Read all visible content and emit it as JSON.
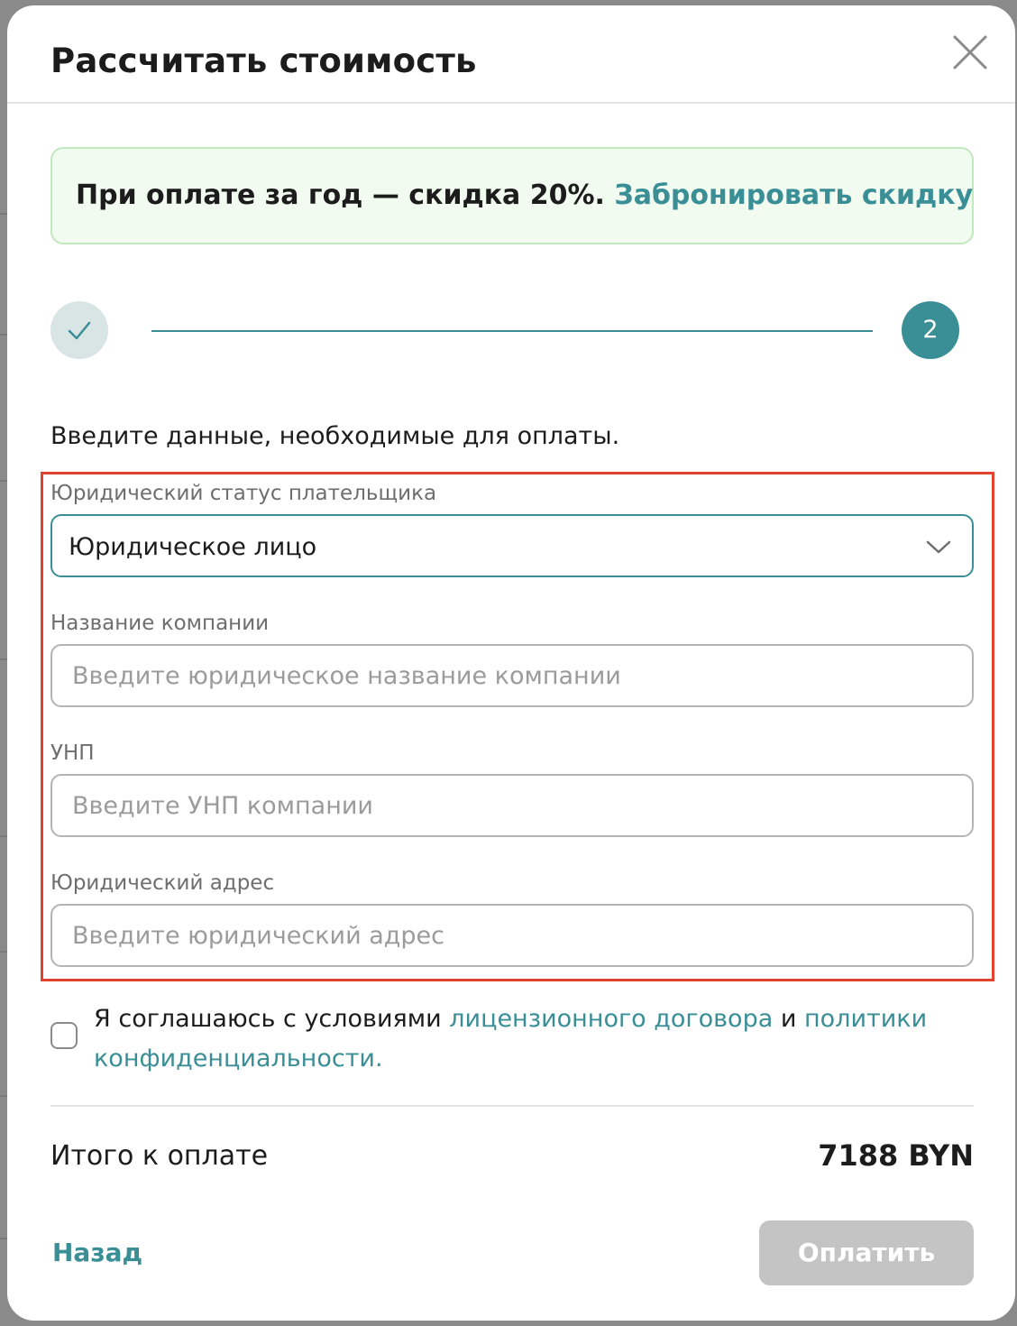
{
  "modal": {
    "title": "Рассчитать стоимость"
  },
  "promo": {
    "text": "При оплате за год — скидка 20%.",
    "link": "Забронировать скидку"
  },
  "stepper": {
    "step2_number": "2"
  },
  "form": {
    "intro": "Введите данные, необходимые для оплаты.",
    "payer_status": {
      "label": "Юридический статус плательщика",
      "value": "Юридическое лицо"
    },
    "company_name": {
      "label": "Название компании",
      "placeholder": "Введите юридическое название компании"
    },
    "unp": {
      "label": "УНП",
      "placeholder": "Введите УНП компании"
    },
    "legal_address": {
      "label": "Юридический адрес",
      "placeholder": "Введите юридический адрес"
    }
  },
  "consent": {
    "prefix": "Я соглашаюсь с условиями",
    "license_link": "лицензионного договора",
    "and": "и",
    "privacy_link": "политики конфиденциальности."
  },
  "summary": {
    "total_label": "Итого к оплате",
    "total_value": "7188 BYN"
  },
  "actions": {
    "back": "Назад",
    "pay": "Оплатить"
  },
  "colors": {
    "accent": "#3a8e96",
    "highlight_border": "#e2432f",
    "promo_bg": "#f1fbef",
    "disabled_button": "#c4c4c4"
  }
}
